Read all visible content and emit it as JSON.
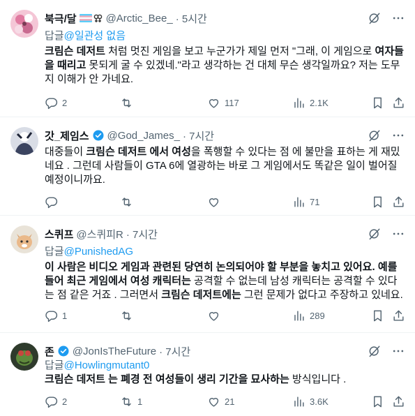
{
  "tweets": [
    {
      "name": "북극/달",
      "emoji": "🏳️‍⚧️⚢",
      "handle": "@Arctic_Bee_",
      "time": "· 5시간",
      "reply_label": "답글",
      "reply_handle": "@일관성 없음",
      "body": [
        {
          "t": "크림슨 데저트",
          "b": true
        },
        {
          "t": " 처럼 멋진 게임을 보고 누군가가 제일 먼저 \"그래, 이 게임으로 ",
          "b": false
        },
        {
          "t": "여자들을 때리고",
          "b": true
        },
        {
          "t": " 못되게 굴 수 있겠네.\"라고 생각하는 건 대체 무슨 생각일까요? 저는 도무지 이해가 안 가네요.",
          "b": false
        }
      ],
      "replies": "2",
      "retweets": "",
      "likes": "117",
      "views": "2.1K"
    },
    {
      "name": "갓_제임스",
      "handle": "@God_James_",
      "time": "· 7시간",
      "body": [
        {
          "t": "대중들이 ",
          "b": false
        },
        {
          "t": "크림슨 데저트 에서 여성",
          "b": true
        },
        {
          "t": "을 폭행할 수 있다는 점 에 불만을 표하는 게 재밌네요 . 그런데 사람들이 GTA 6에 열광하는 바로 그 게임에서도 똑같은 일이 벌어질 예정이니까요.",
          "b": false
        }
      ],
      "replies": "",
      "retweets": "",
      "likes": "",
      "views": "71"
    },
    {
      "name": "스퀴프",
      "handle": "@스퀴피R",
      "time": "· 7시간",
      "reply_label": "답글",
      "reply_handle": "@PunishedAG",
      "body": [
        {
          "t": "이 사람은 비디오 게임과 관련된 당연히 논의되어야 할 부분을 놓치고 있어요. 예를 들어 최근 게임에서 여성 캐릭터는",
          "b": true
        },
        {
          "t": " 공격할 수 없는데 남성 캐릭터는 공격할 수 있다는 점 같은 거죠 . 그러면서 ",
          "b": false
        },
        {
          "t": "크림슨 데저트에는",
          "b": true
        },
        {
          "t": " 그런 문제가 없다고 주장하고 있네요.",
          "b": false
        }
      ],
      "replies": "1",
      "retweets": "",
      "likes": "",
      "views": "289"
    },
    {
      "name": "존",
      "handle": "@JonIsTheFuture",
      "time": "· 7시간",
      "reply_label": "답글",
      "reply_handle": "@Howlingmutant0",
      "body": [
        {
          "t": "크림슨 데저트 는 폐경 전 여성들이 생리 기간을 묘사하는",
          "b": true
        },
        {
          "t": " 방식입니다 .",
          "b": false
        }
      ],
      "replies": "2",
      "retweets": "1",
      "likes": "21",
      "views": "3.6K"
    }
  ],
  "icons": {
    "reply": "reply-icon",
    "retweet": "retweet-icon",
    "like": "heart-icon",
    "views": "views-icon",
    "bookmark": "bookmark-icon",
    "share": "share-icon",
    "grok": "grok-icon",
    "more": "more-icon",
    "verified": "verified-badge-icon"
  },
  "colors": {
    "link": "#1d9bf0",
    "secondary": "#536471",
    "text": "#0f1419"
  }
}
